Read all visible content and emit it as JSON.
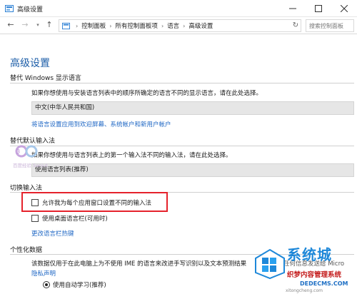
{
  "window": {
    "title": "高级设置",
    "icons": {
      "app": "control-panel-icon",
      "minimize": "minimize-icon",
      "maximize": "maximize-icon",
      "close": "close-icon"
    }
  },
  "address": {
    "breadcrumbs": [
      "控制面板",
      "所有控制面板项",
      "语言",
      "高级设置"
    ],
    "search_placeholder": "搜索控制面板"
  },
  "page": {
    "title": "高级设置"
  },
  "display_language": {
    "heading": "替代 Windows 显示语言",
    "description": "如果你想使用与安装语言列表中的顺序所确定的语言不同的显示语言，请在此处选择。",
    "selected": "中文(中华人民共和国)",
    "link": "将语言设置应用到欢迎屏幕、系统帐户和新用户帐户"
  },
  "default_input": {
    "heading": "替代默认输入法",
    "description": "如果你想使用与语言列表上的第一个输入法不同的输入法，请在此处选择。",
    "selected": "使用语言列表(推荐)"
  },
  "switch_input": {
    "heading": "切换输入法",
    "checkbox1": "允许我为每个应用窗口设置不同的输入法",
    "checkbox1_checked": false,
    "checkbox2": "使用桌面语言栏(可用时)",
    "checkbox2_checked": false,
    "link": "更改语言栏热键"
  },
  "personalization": {
    "heading": "个性化数据",
    "description": "该数据仅用于在此电脑上为不使用 IME 的语言来改进手写识别以及文本预测结果",
    "description_tail": "会将任何信息发送给 Micro",
    "link": "隐私声明",
    "radio1": "使用自动学习(推荐)"
  },
  "watermarks": {
    "left": "百度经验 Sanjut",
    "right_title": "系统城",
    "right_sub": "织梦内容管理系统",
    "right_url": "DEDECMS.COM",
    "right_small": "xitongcheng.com"
  },
  "colors": {
    "accent": "#1d5ea8",
    "link": "#1d66c4",
    "highlight": "#e5222b"
  }
}
